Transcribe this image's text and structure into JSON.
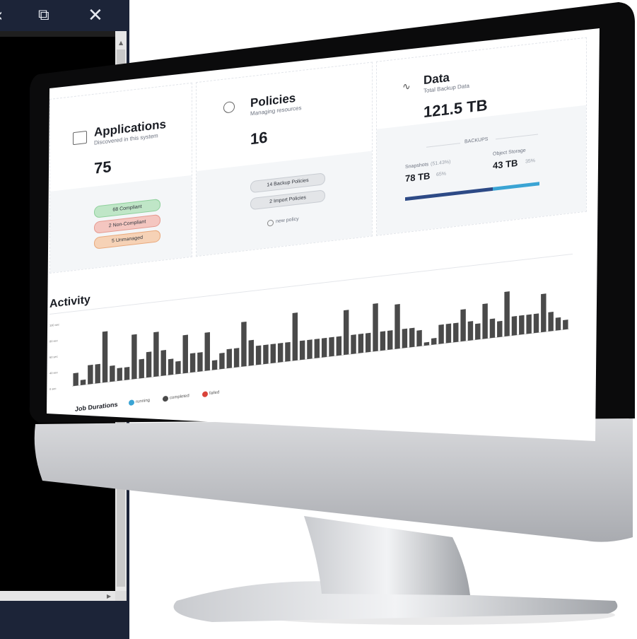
{
  "window": {
    "minimize_icon": "minimize-icon",
    "restore_icon": "restore-icon",
    "close_icon": "close-icon",
    "restore_glyph": "⧉",
    "close_glyph": "✕",
    "minimize_glyph": "‹"
  },
  "cards": {
    "applications": {
      "title": "Applications",
      "subtitle": "Discovered in this system",
      "count": "75",
      "pills": [
        "68 Compliant",
        "2 Non-Compliant",
        "5 Unmanaged"
      ]
    },
    "policies": {
      "title": "Policies",
      "subtitle": "Managing resources",
      "count": "16",
      "pills": [
        "14 Backup Policies",
        "2 Import Policies"
      ],
      "new_policy": "new policy"
    },
    "data": {
      "title": "Data",
      "subtitle": "Total Backup Data",
      "total": "121.5 TB",
      "backups_label": "BACKUPS",
      "snapshots_label": "Snapshots",
      "snapshots_extra": "(51.43%)",
      "snapshots_value": "78 TB",
      "snapshots_pct": "65%",
      "object_label": "Object Storage",
      "object_value": "43 TB",
      "object_pct": "35%",
      "snapshots_share": 0.65
    }
  },
  "activity": {
    "title": "Activity",
    "legend_title": "Job Durations",
    "legend": [
      {
        "label": "running",
        "color": "#3aa4d4"
      },
      {
        "label": "completed",
        "color": "#4a4a4a"
      },
      {
        "label": "failed",
        "color": "#d9433a"
      }
    ],
    "y_ticks": [
      "100 sec",
      "80 sec",
      "60 sec",
      "40 sec",
      "0 sec"
    ]
  },
  "chart_data": {
    "type": "bar",
    "title": "Activity",
    "ylim": [
      0,
      100
    ],
    "y_tick_labels": [
      "100 sec",
      "80 sec",
      "60 sec",
      "40 sec",
      "0 sec"
    ],
    "series": [
      {
        "name": "completed",
        "values": [
          20,
          8,
          30,
          30,
          80,
          25,
          20,
          20,
          70,
          30,
          40,
          70,
          40,
          25,
          20,
          60,
          30,
          30,
          60,
          15,
          25,
          30,
          30,
          70,
          40,
          30,
          30,
          30,
          30,
          30,
          75,
          30,
          30,
          30,
          30,
          30,
          30,
          70,
          30,
          30,
          30,
          75,
          30,
          30,
          70,
          30,
          30,
          25,
          5,
          10,
          30,
          30,
          30,
          50,
          30,
          25,
          55,
          30,
          25,
          70,
          30,
          30,
          30,
          30,
          60,
          30,
          20,
          15
        ]
      }
    ]
  }
}
